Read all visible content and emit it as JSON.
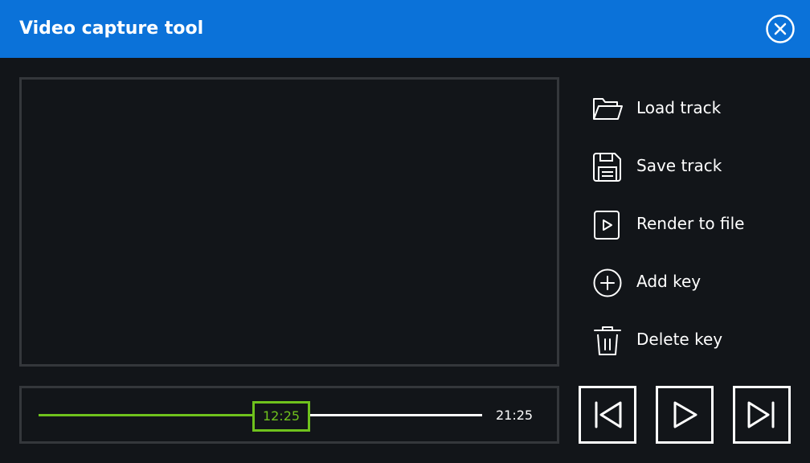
{
  "window": {
    "title": "Video capture tool",
    "header_color": "#0b72d9",
    "close_icon": "close-circle-icon"
  },
  "actions": [
    {
      "label": "Load track",
      "icon": "folder-open-icon"
    },
    {
      "label": "Save track",
      "icon": "floppy-disk-icon"
    },
    {
      "label": "Render to file",
      "icon": "play-file-icon"
    },
    {
      "label": "Add key",
      "icon": "plus-circle-icon"
    },
    {
      "label": "Delete key",
      "icon": "trash-icon"
    }
  ],
  "timeline": {
    "current_time": "12:25",
    "total_time": "21:25",
    "progress_fraction": 0.58,
    "accent_color": "#6fc21d"
  },
  "transport": {
    "prev_icon": "skip-back-icon",
    "play_icon": "play-icon",
    "next_icon": "skip-forward-icon"
  }
}
